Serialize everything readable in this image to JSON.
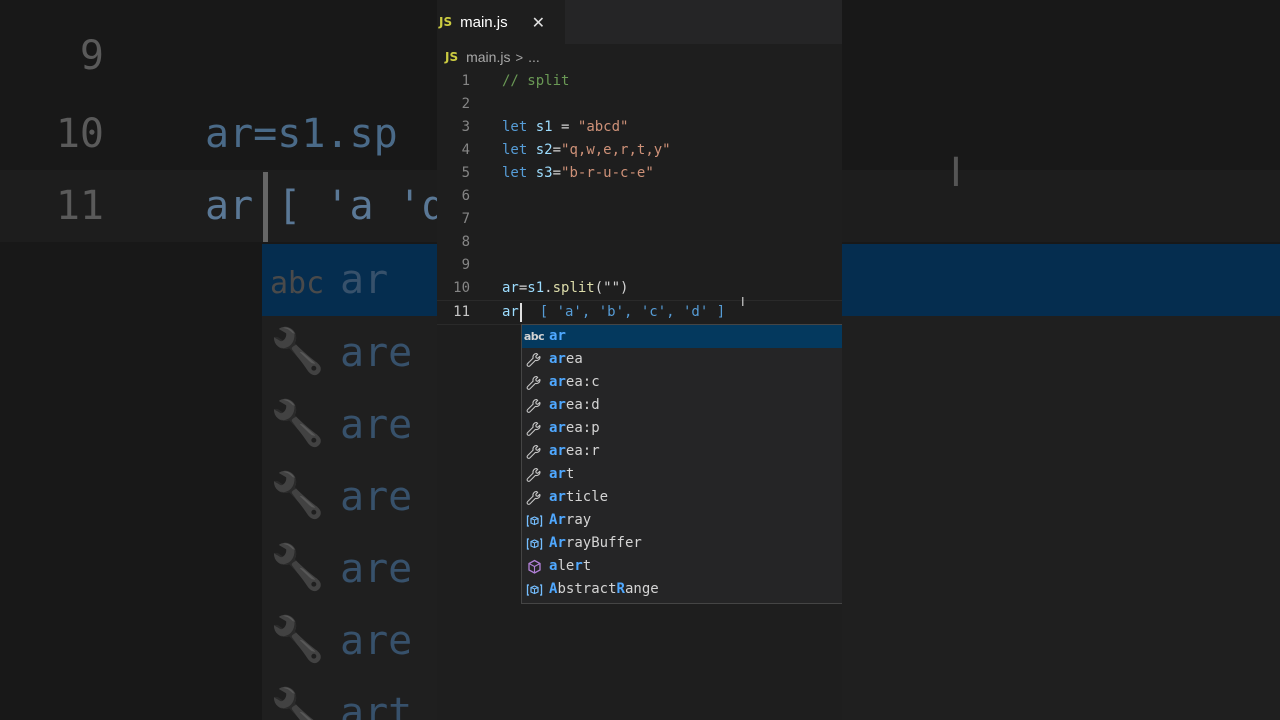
{
  "tab": {
    "badge": "JS",
    "file": "main.js",
    "close": "✕"
  },
  "breadcrumb": {
    "badge": "JS",
    "file": "main.js",
    "sep": ">",
    "rest": "..."
  },
  "editor": {
    "lines": [
      {
        "n": "1",
        "tokens": [
          {
            "t": "// split",
            "c": "com"
          }
        ]
      },
      {
        "n": "2",
        "tokens": []
      },
      {
        "n": "3",
        "tokens": [
          {
            "t": "let",
            "c": "kw"
          },
          {
            "t": " "
          },
          {
            "t": "s1",
            "c": "var"
          },
          {
            "t": " = "
          },
          {
            "t": "\"abcd\"",
            "c": "str"
          }
        ]
      },
      {
        "n": "4",
        "tokens": [
          {
            "t": "let",
            "c": "kw"
          },
          {
            "t": " "
          },
          {
            "t": "s2",
            "c": "var"
          },
          {
            "t": "="
          },
          {
            "t": "\"q,w,e,r,t,y\"",
            "c": "str"
          }
        ]
      },
      {
        "n": "5",
        "tokens": [
          {
            "t": "let",
            "c": "kw"
          },
          {
            "t": " "
          },
          {
            "t": "s3",
            "c": "var"
          },
          {
            "t": "="
          },
          {
            "t": "\"b-r-u-c-e\"",
            "c": "str"
          }
        ]
      },
      {
        "n": "6",
        "tokens": []
      },
      {
        "n": "7",
        "tokens": []
      },
      {
        "n": "8",
        "tokens": []
      },
      {
        "n": "9",
        "tokens": []
      },
      {
        "n": "10",
        "tokens": [
          {
            "t": "ar",
            "c": "var"
          },
          {
            "t": "="
          },
          {
            "t": "s1",
            "c": "var"
          },
          {
            "t": "."
          },
          {
            "t": "split",
            "c": "fn"
          },
          {
            "t": "(\"\")"
          }
        ]
      },
      {
        "n": "11",
        "tokens": [
          {
            "t": "ar",
            "c": "var"
          }
        ],
        "inlay": "  [ 'a', 'b', 'c', 'd' ]",
        "active": true
      }
    ]
  },
  "suggestions": [
    {
      "icon": "abc",
      "label": "ar",
      "hl": 2,
      "selected": true
    },
    {
      "icon": "wrench",
      "label": "area",
      "hl": 2
    },
    {
      "icon": "wrench",
      "label": "area:c",
      "hl": 2
    },
    {
      "icon": "wrench",
      "label": "area:d",
      "hl": 2
    },
    {
      "icon": "wrench",
      "label": "area:p",
      "hl": 2
    },
    {
      "icon": "wrench",
      "label": "area:r",
      "hl": 2
    },
    {
      "icon": "wrench",
      "label": "art",
      "hl": 2
    },
    {
      "icon": "wrench",
      "label": "article",
      "hl": 2
    },
    {
      "icon": "variable",
      "label": "Array",
      "hl": 2
    },
    {
      "icon": "variable",
      "label": "ArrayBuffer",
      "hl": 2
    },
    {
      "icon": "method",
      "label": "alert",
      "hlIdx": [
        0,
        3
      ]
    },
    {
      "icon": "variable",
      "label": "AbstractRange",
      "hlIdx": [
        0,
        8
      ]
    }
  ],
  "background": {
    "rows": [
      {
        "n": "9",
        "code": ""
      },
      {
        "n": "10",
        "code": "ar=s1.sp"
      },
      {
        "n": "11",
        "code": "ar   [ 'a                          'd'  ]"
      }
    ],
    "items": [
      "ar",
      "are",
      "are",
      "are",
      "are",
      "are",
      "art"
    ]
  },
  "colors": {
    "accent": "#4fa8ff",
    "selection": "#04395e",
    "method": "#b180d7"
  }
}
